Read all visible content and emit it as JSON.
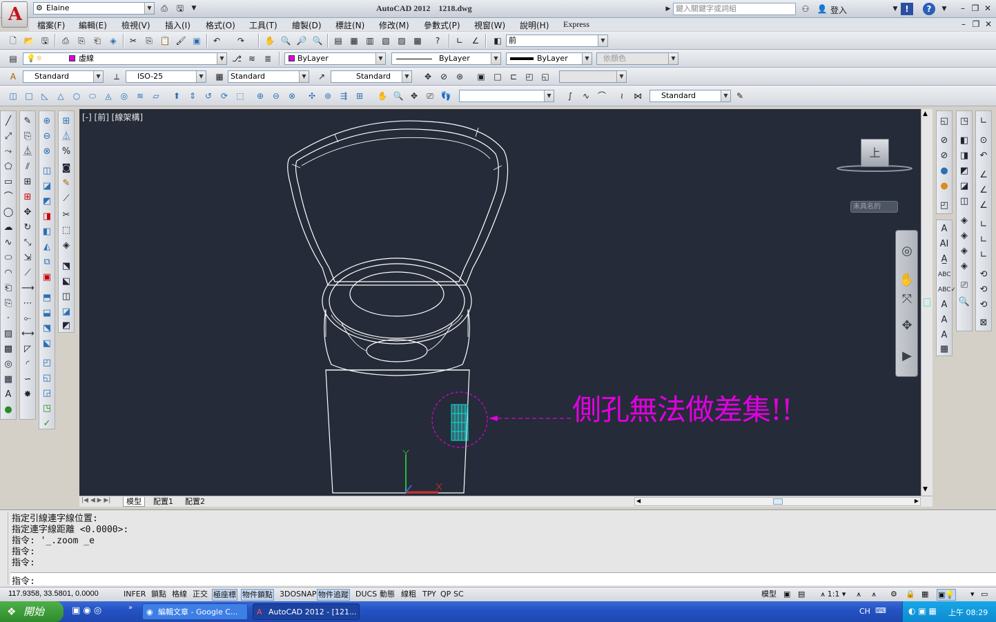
{
  "app": {
    "title": "AutoCAD 2012",
    "file": "1218.dwg",
    "workspace": "Elaine",
    "search_placeholder": "鍵入關鍵字或詞組",
    "login": "登入"
  },
  "menu": [
    "檔案(F)",
    "編輯(E)",
    "檢視(V)",
    "插入(I)",
    "格式(O)",
    "工具(T)",
    "繪製(D)",
    "標註(N)",
    "修改(M)",
    "參數式(P)",
    "視窗(W)",
    "說明(H)",
    "Express"
  ],
  "toolbar": {
    "view_combo": "前",
    "layer_combo": "虛線",
    "color_combo": "ByLayer",
    "linetype_combo": "ByLayer",
    "lineweight_combo": "ByLayer",
    "plotstyle_combo": "依顏色",
    "text_style": "Standard",
    "dim_style": "ISO-25",
    "table_style": "Standard",
    "mleader_style": "Standard",
    "visual_style": "Standard"
  },
  "viewport": {
    "label": "[-] [前] [線架構]",
    "viewcube_face": "上",
    "ucs_name": "未具名的",
    "annotation": "側孔無法做差集!!",
    "annotation_color": "#e000e0",
    "background": "#252b38"
  },
  "layout_tabs": [
    "模型",
    "配置1",
    "配置2"
  ],
  "command": {
    "history": [
      "指定引線連字線位置:",
      "指定連字線距離 <0.0000>:",
      "指令: '_.zoom _e",
      "指令:",
      "指令:"
    ],
    "prompt": "指令:"
  },
  "status": {
    "coords": "117.9358, 33.5801, 0.0000",
    "toggles": [
      "INFER",
      "鎖點",
      "格線",
      "正交",
      "極座標",
      "物件鎖點",
      "3DOSNAP",
      "物件追蹤",
      "DUCS",
      "動態",
      "線粗",
      "TPY",
      "QP",
      "SC"
    ],
    "active": [
      "極座標",
      "物件鎖點",
      "物件追蹤"
    ],
    "model": "模型",
    "scale": "1:1"
  },
  "taskbar": {
    "start": "開始",
    "tasks": [
      "編輯文章 - Google C...",
      "AutoCAD 2012 - [121..."
    ],
    "lang": "CH",
    "clock": "上午 08:29"
  }
}
